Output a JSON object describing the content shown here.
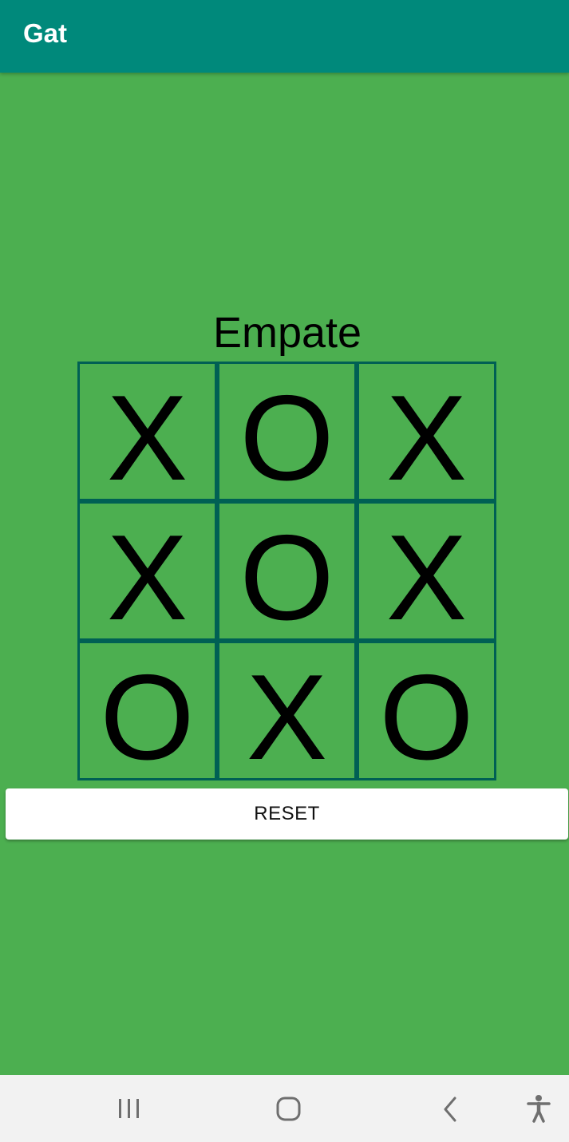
{
  "app_bar": {
    "title": "Gat",
    "color": "#00897B"
  },
  "game": {
    "status": "Empate",
    "board": [
      [
        "X",
        "O",
        "X"
      ],
      [
        "X",
        "O",
        "X"
      ],
      [
        "O",
        "X",
        "O"
      ]
    ],
    "background_color": "#4CAF50",
    "grid_line_color": "#006054"
  },
  "reset_button": {
    "label": "RESET"
  },
  "nav_bar": {
    "icons": [
      "recent-apps-icon",
      "home-icon",
      "back-icon",
      "accessibility-icon"
    ]
  }
}
